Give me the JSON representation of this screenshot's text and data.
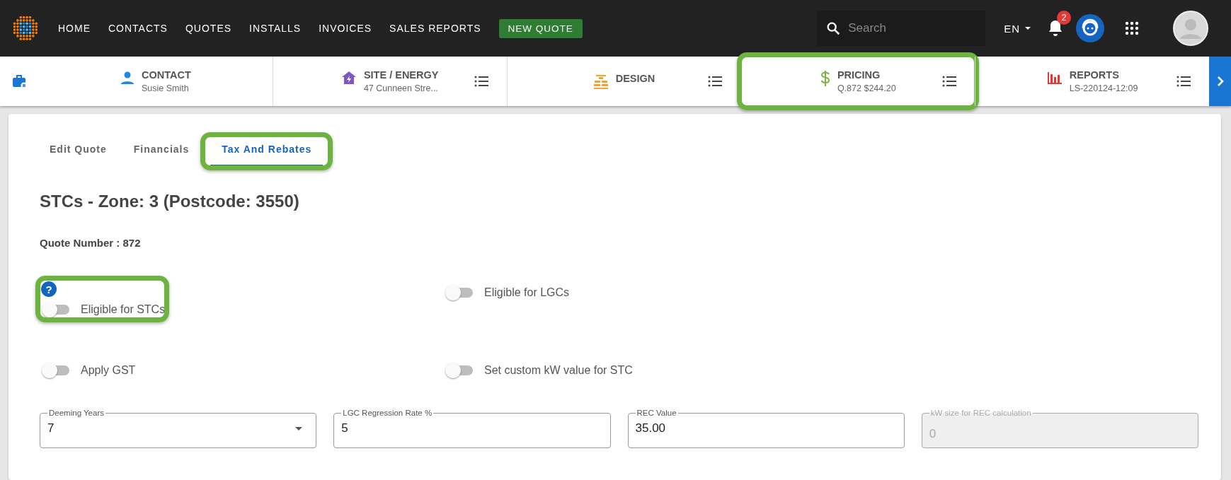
{
  "top_nav": {
    "items": [
      "HOME",
      "CONTACTS",
      "QUOTES",
      "INSTALLS",
      "INVOICES",
      "SALES REPORTS"
    ],
    "new_quote_button": "NEW QUOTE",
    "search": {
      "placeholder": "Search"
    },
    "language": "EN",
    "notification_count": "2"
  },
  "steps": [
    {
      "kind": "contact",
      "title": "CONTACT",
      "subtitle": "Susie Smith",
      "menu": false,
      "highlighted": false
    },
    {
      "kind": "site",
      "title": "SITE / ENERGY",
      "subtitle": "47 Cunneen Stre...",
      "menu": true,
      "highlighted": false
    },
    {
      "kind": "design",
      "title": "DESIGN",
      "menu": true,
      "highlighted": false
    },
    {
      "kind": "pricing",
      "title": "PRICING",
      "subtitle": "Q.872 $244.20",
      "menu": true,
      "highlighted": true
    },
    {
      "kind": "reports",
      "title": "REPORTS",
      "subtitle": "LS-220124-12:09",
      "menu": true,
      "highlighted": false
    }
  ],
  "tabs": [
    {
      "label": "Edit Quote",
      "selected": false,
      "highlighted": false
    },
    {
      "label": "Financials",
      "selected": false,
      "highlighted": false
    },
    {
      "label": "Tax And Rebates",
      "selected": true,
      "highlighted": true
    }
  ],
  "heading": "STCs - Zone: 3 (Postcode: 3550)",
  "quote_number": "Quote Number : 872",
  "toggles": [
    {
      "label": "Eligible for STCs",
      "on": false,
      "help": "?",
      "highlighted": true
    },
    {
      "label": "Eligible for LGCs",
      "on": false,
      "highlighted": false
    },
    {
      "label": "Apply GST",
      "on": false,
      "highlighted": false
    },
    {
      "label": "Set custom kW value for STC",
      "on": false,
      "highlighted": false
    }
  ],
  "fields": [
    {
      "kind": "select",
      "label": "Deeming Years",
      "value": "7",
      "disabled": false
    },
    {
      "kind": "text",
      "label": "LGC Regression Rate %",
      "value": "5",
      "disabled": false
    },
    {
      "kind": "text",
      "label": "REC Value",
      "value": "35.00",
      "disabled": false
    },
    {
      "kind": "text",
      "label": "kW size for REC calculation",
      "value": "0",
      "disabled": true
    }
  ]
}
